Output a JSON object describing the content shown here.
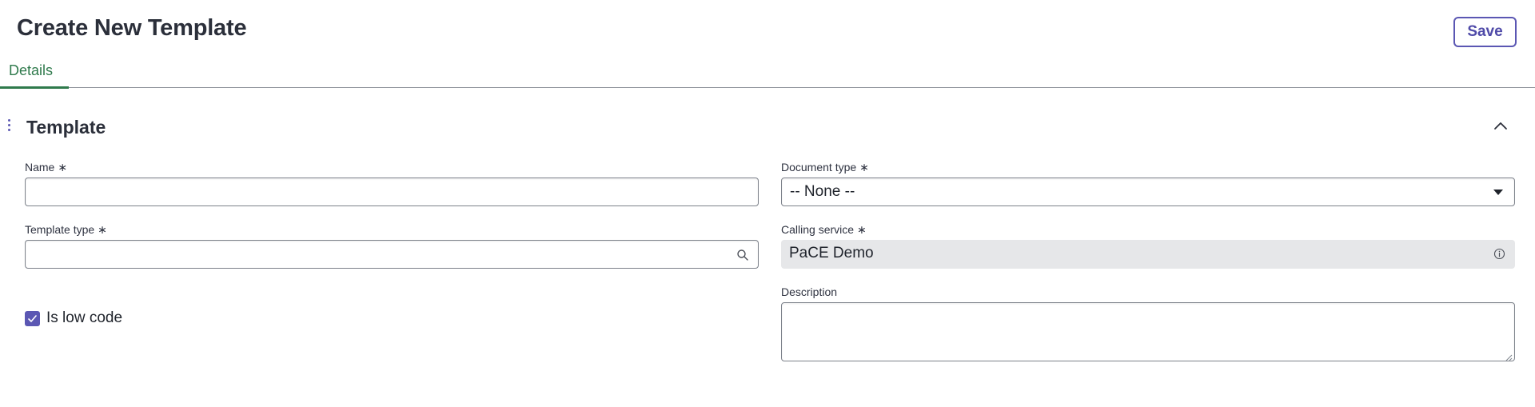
{
  "header": {
    "title": "Create New Template",
    "save_label": "Save"
  },
  "tabs": [
    {
      "label": "Details",
      "active": true
    }
  ],
  "section": {
    "title": "Template",
    "expanded": true
  },
  "fields": {
    "name": {
      "label": "Name",
      "required_mark": "∗",
      "value": "",
      "placeholder": ""
    },
    "template_type": {
      "label": "Template type",
      "required_mark": "∗",
      "value": "",
      "placeholder": "",
      "icon": "search-icon"
    },
    "document_type": {
      "label": "Document type",
      "required_mark": "∗",
      "selected": "-- None --"
    },
    "calling_service": {
      "label": "Calling service",
      "required_mark": "∗",
      "value": "PaCE Demo",
      "icon": "info-icon"
    },
    "description": {
      "label": "Description",
      "value": ""
    },
    "is_low_code": {
      "label": "Is low code",
      "checked": true
    }
  },
  "colors": {
    "accent": "#5b57b3",
    "tab_active": "#2f7a4c",
    "readonly_bg": "#e6e7e9"
  }
}
